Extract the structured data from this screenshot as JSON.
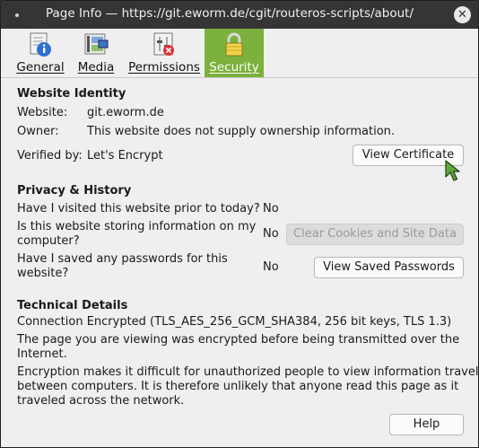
{
  "window": {
    "title": "Page Info — https://git.eworm.de/cgit/routeros-scripts/about/",
    "close_glyph": "✕"
  },
  "tabs": [
    {
      "label": "General",
      "icon": "general-info-icon"
    },
    {
      "label": "Media",
      "icon": "media-icon"
    },
    {
      "label": "Permissions",
      "icon": "permissions-icon"
    },
    {
      "label": "Security",
      "icon": "lock-icon",
      "active": true
    }
  ],
  "identity": {
    "heading": "Website Identity",
    "website_label": "Website:",
    "website_value": "git.eworm.de",
    "owner_label": "Owner:",
    "owner_value": "This website does not supply ownership information.",
    "verified_label": "Verified by:",
    "verified_value": "Let's Encrypt",
    "view_certificate": "View Certificate"
  },
  "privacy": {
    "heading": "Privacy & History",
    "q1": "Have I visited this website prior to today?",
    "a1": "No",
    "q2_line1": "Is this website storing information on my",
    "q2_line2": "computer?",
    "a2": "No",
    "clear_cookies": "Clear Cookies and Site Data",
    "q3_line1": "Have I saved any passwords for this",
    "q3_line2": "website?",
    "a3": "No",
    "view_passwords": "View Saved Passwords"
  },
  "technical": {
    "heading": "Technical Details",
    "connection": "Connection Encrypted (TLS_AES_256_GCM_SHA384, 256 bit keys, TLS 1.3)",
    "p1_line1": "The page you are viewing was encrypted before being transmitted over the",
    "p1_line2": "Internet.",
    "p2_line1": "Encryption makes it difficult for unauthorized people to view information traveling",
    "p2_line2": "between computers. It is therefore unlikely that anyone read this page as it",
    "p2_line3": "traveled across the network."
  },
  "footer": {
    "help": "Help"
  },
  "colors": {
    "accent": "#7bb13c",
    "titlebar": "#353535",
    "background": "#efefef"
  }
}
